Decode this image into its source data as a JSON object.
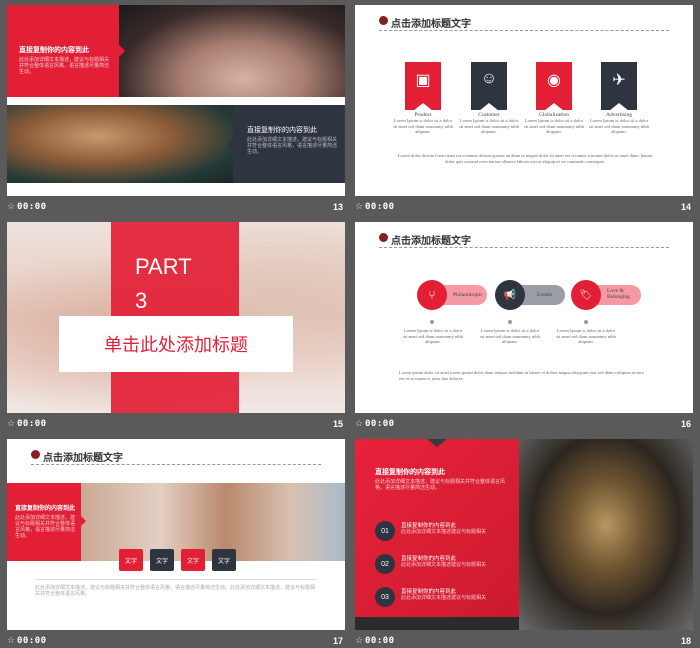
{
  "common": {
    "header_title": "点击添加标题文字",
    "time": "00:00",
    "star": "☆"
  },
  "slides": [
    {
      "number": "13",
      "block1": {
        "title": "直接复制你的内容到此",
        "body": "此处添加详细文本描述，建议与标题相关并符合整体语言风格，语言描述尽量简洁生动。"
      },
      "block2": {
        "title": "直接复制你的内容到此",
        "body": "此处添加详细文本描述，建议与标题相关并符合整体语言风格，语言描述尽量简洁生动。"
      }
    },
    {
      "number": "14",
      "items": [
        {
          "icon": "box-icon",
          "glyph": "▣",
          "title": "Product",
          "body": "Lorem Ipsum is dolor sit a dolor sit amet sed diam nonummy nibh aliquam."
        },
        {
          "icon": "people-icon",
          "glyph": "☺",
          "title": "Customer",
          "body": "Lorem Ipsum is dolor sit a dolor sit amet sed diam nonummy nibh aliquam."
        },
        {
          "icon": "globe-icon",
          "glyph": "◉",
          "title": "Globalization",
          "body": "Lorem Ipsum is dolor sit a dolor sit amet sed diam nonummy nibh aliquam."
        },
        {
          "icon": "plane-icon",
          "glyph": "✈",
          "title": "Advertising",
          "body": "Lorem Ipsum is dolor sit a dolor sit amet sed diam nonummy nibh aliquam."
        }
      ],
      "footer": "Lorem dolor dictum lorem tiam est vivamus dictum quistas an diam ut magna dolor sit amet est vivamus wirtuum dolor sit amet diam. Ipsum dolor quis nostrud exercitation ullamco laboris nisi ut aliquip ex ea commodo consequat."
    },
    {
      "number": "15",
      "part_label": "PART",
      "part_number": "3",
      "title": "单击此处添加标题"
    },
    {
      "number": "16",
      "items": [
        {
          "icon": "branch-icon",
          "glyph": "⑂",
          "label": "Philanthropic",
          "body": "Lorem Ipsum is dolor sit a dolor sit amet sed diam nonummy nibh aliquam."
        },
        {
          "icon": "megaphone-icon",
          "glyph": "📢",
          "label": "Events",
          "body": "Lorem Ipsum is dolor sit a dolor sit amet sed diam nonummy nibh aliquam."
        },
        {
          "icon": "tag-icon",
          "glyph": "🏷",
          "label": "Love & Belonging",
          "body": "Lorem Ipsum is dolor sit a dolor sit amet sed diam nonummy nibh aliquam."
        }
      ],
      "footer": "Lorem ipsum dolor sit amet lorem ipsum dolor diam tempor invidunt ut labore et dolore magna aliquyam erat sed diam voluptua at vero eos et accusam et justo duo dolores."
    },
    {
      "number": "17",
      "block": {
        "title": "直接复制你的内容到此",
        "body": "此处添加详细文本描述，建议与标题相关并符合整体语言风格，语言描述尽量简洁生动。"
      },
      "buttons": [
        "文字",
        "文字",
        "文字",
        "文字"
      ],
      "footer": "此处添加详细文本描述，建议与标题相关并符合整体语言风格，语言描述尽量简洁生动。此处添加详细文本描述，建议与标题相关并符合整体语言风格。"
    },
    {
      "number": "18",
      "title": "直接复制你的内容到此",
      "body": "此处添加详细文本描述，建议与标题相关并符合整体语言风格，语言描述尽量简洁生动。",
      "items": [
        {
          "num": "01",
          "title": "直接复制你的内容到此",
          "body": "此处添加详细文本描述建议与标题相关"
        },
        {
          "num": "02",
          "title": "直接复制你的内容到此",
          "body": "此处添加详细文本描述建议与标题相关"
        },
        {
          "num": "03",
          "title": "直接复制你的内容到此",
          "body": "此处添加详细文本描述建议与标题相关"
        }
      ]
    }
  ]
}
